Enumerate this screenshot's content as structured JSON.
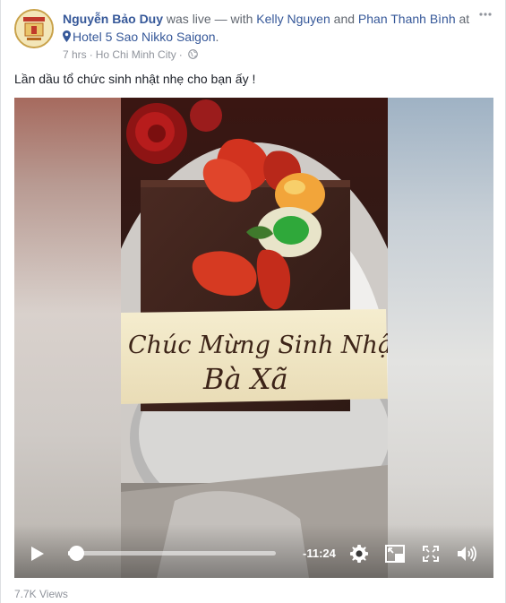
{
  "post": {
    "author": "Nguyễn Bảo Duy",
    "status_text": "was live — with",
    "tagged": [
      "Kelly Nguyen",
      "Phan Thanh Bình"
    ],
    "and_text": "and",
    "at_text": "at",
    "location": "Hotel 5 Sao Nikko Saigon",
    "period": ".",
    "time_ago": "7 hrs",
    "separator": "·",
    "city": "Ho Chi Minh City",
    "privacy_icon": "globe-icon",
    "more_icon": "more-options-icon",
    "caption": "Lần dầu tổ chức sinh nhật nhẹ cho bạn ấy !",
    "views": "7.7K Views"
  },
  "video": {
    "remaining_time": "-11:24",
    "progress": 0.01,
    "cake_text_line1": "Chúc Mừng Sinh Nhật",
    "cake_text_line2": "Bà Xã",
    "controls": [
      "play-icon",
      "settings-icon",
      "pip-icon",
      "fullscreen-icon",
      "volume-icon"
    ]
  },
  "colors": {
    "link": "#365899",
    "meta": "#90949c",
    "text": "#1d2129"
  }
}
